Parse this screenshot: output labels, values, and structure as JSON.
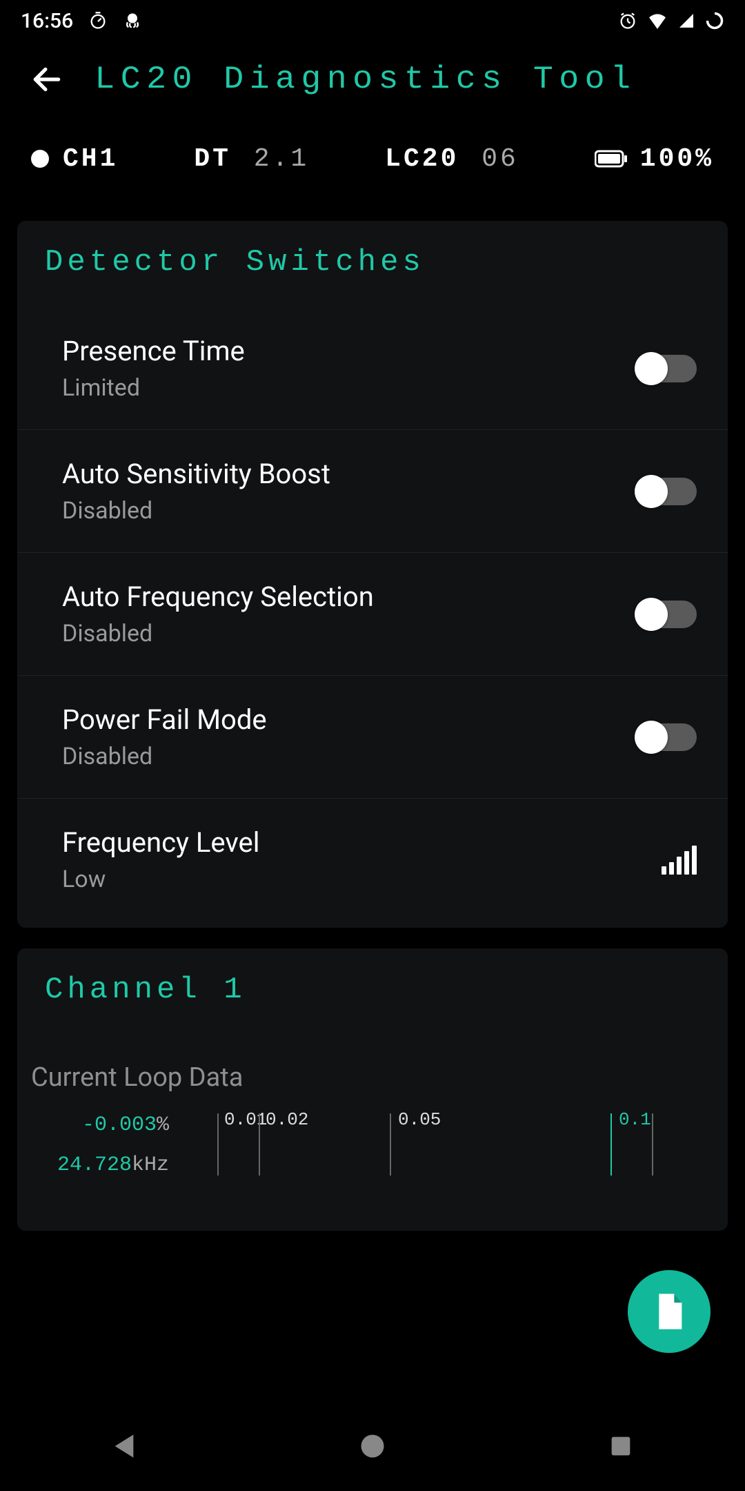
{
  "status_bar": {
    "time": "16:56"
  },
  "header": {
    "title": "LC20 Diagnostics Tool"
  },
  "info": {
    "channel": "CH1",
    "dt_label": "DT",
    "dt_value": "2.1",
    "lc_label": "LC20",
    "lc_value": "06",
    "battery": "100%"
  },
  "switches": {
    "title": "Detector Switches",
    "items": [
      {
        "title": "Presence Time",
        "sub": "Limited",
        "on": false,
        "kind": "toggle"
      },
      {
        "title": "Auto Sensitivity Boost",
        "sub": "Disabled",
        "on": false,
        "kind": "toggle"
      },
      {
        "title": "Auto Frequency Selection",
        "sub": "Disabled",
        "on": false,
        "kind": "toggle"
      },
      {
        "title": "Power Fail Mode",
        "sub": "Disabled",
        "on": false,
        "kind": "toggle"
      },
      {
        "title": "Frequency Level",
        "sub": "Low",
        "kind": "bars"
      }
    ]
  },
  "channel": {
    "title": "Channel 1",
    "loop_label": "Current Loop Data",
    "pct_value": "-0.003",
    "pct_unit": "%",
    "khz_value": "24.728",
    "khz_unit": "kHz",
    "ticks": {
      "a": "0.01",
      "b": "0.02",
      "c": "0.05",
      "d": "0.1"
    }
  }
}
